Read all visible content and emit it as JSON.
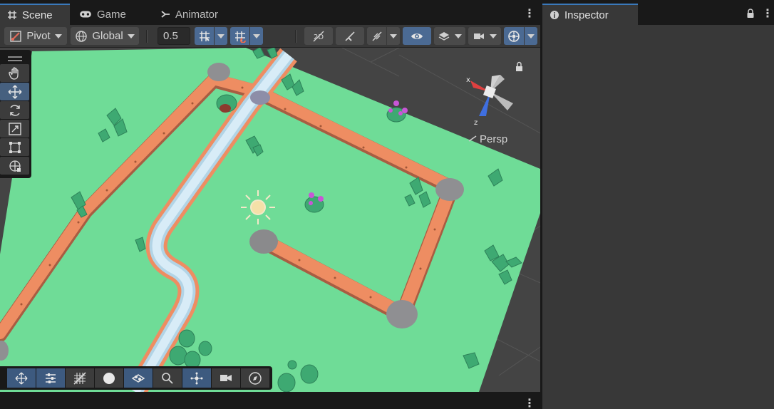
{
  "tabs": {
    "scene": "Scene",
    "game": "Game",
    "animator": "Animator",
    "inspector": "Inspector"
  },
  "toolbar": {
    "pivot_label": "Pivot",
    "global_label": "Global",
    "snap_value": "0.5"
  },
  "scene": {
    "projection_label": "Persp",
    "gizmo_axes": {
      "x": "x",
      "z": "z"
    }
  },
  "colors": {
    "accent": "#3a79bb",
    "grass": "#6fdc97",
    "path": "#ee8d62",
    "river": "#d8ecf7",
    "tree": "#3ea972",
    "rock": "#8f8f92"
  }
}
